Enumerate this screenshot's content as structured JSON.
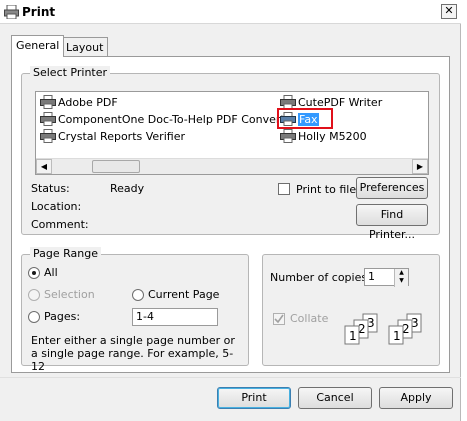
{
  "window": {
    "title": "Print"
  },
  "tabs": [
    {
      "label": "General"
    },
    {
      "label": "Layout"
    }
  ],
  "select_printer": {
    "title": "Select Printer",
    "printers": [
      {
        "name": "Adobe PDF",
        "icon": "printer-icon"
      },
      {
        "name": "CutePDF Writer",
        "icon": "printer-icon"
      },
      {
        "name": "ComponentOne Doc-To-Help PDF Converter",
        "icon": "printer-icon"
      },
      {
        "name": "Fax",
        "icon": "fax-printer-icon",
        "selected": true
      },
      {
        "name": "Crystal Reports Verifier",
        "icon": "printer-icon"
      },
      {
        "name": "Holly M5200",
        "icon": "printer-icon"
      }
    ],
    "status_label": "Status:",
    "status_value": "Ready",
    "location_label": "Location:",
    "location_value": "",
    "comment_label": "Comment:",
    "comment_value": "",
    "print_to_file_label": "Print to file",
    "print_to_file_checked": false,
    "preferences_button": "Preferences",
    "find_printer_button": "Find Printer..."
  },
  "page_range": {
    "title": "Page Range",
    "all_label": "All",
    "selection_label": "Selection",
    "current_page_label": "Current Page",
    "pages_label": "Pages:",
    "pages_value": "1-4",
    "selected_option": "All",
    "hint": "Enter either a single page number or a single page range.  For example, 5-12"
  },
  "copies": {
    "number_label": "Number of copies:",
    "number_value": "1",
    "collate_label": "Collate",
    "collate_checked": true,
    "collate_disabled": true
  },
  "footer": {
    "print_button": "Print",
    "cancel_button": "Cancel",
    "apply_button": "Apply"
  },
  "colors": {
    "selection": "#3399ff",
    "highlight": "#e0101a"
  }
}
